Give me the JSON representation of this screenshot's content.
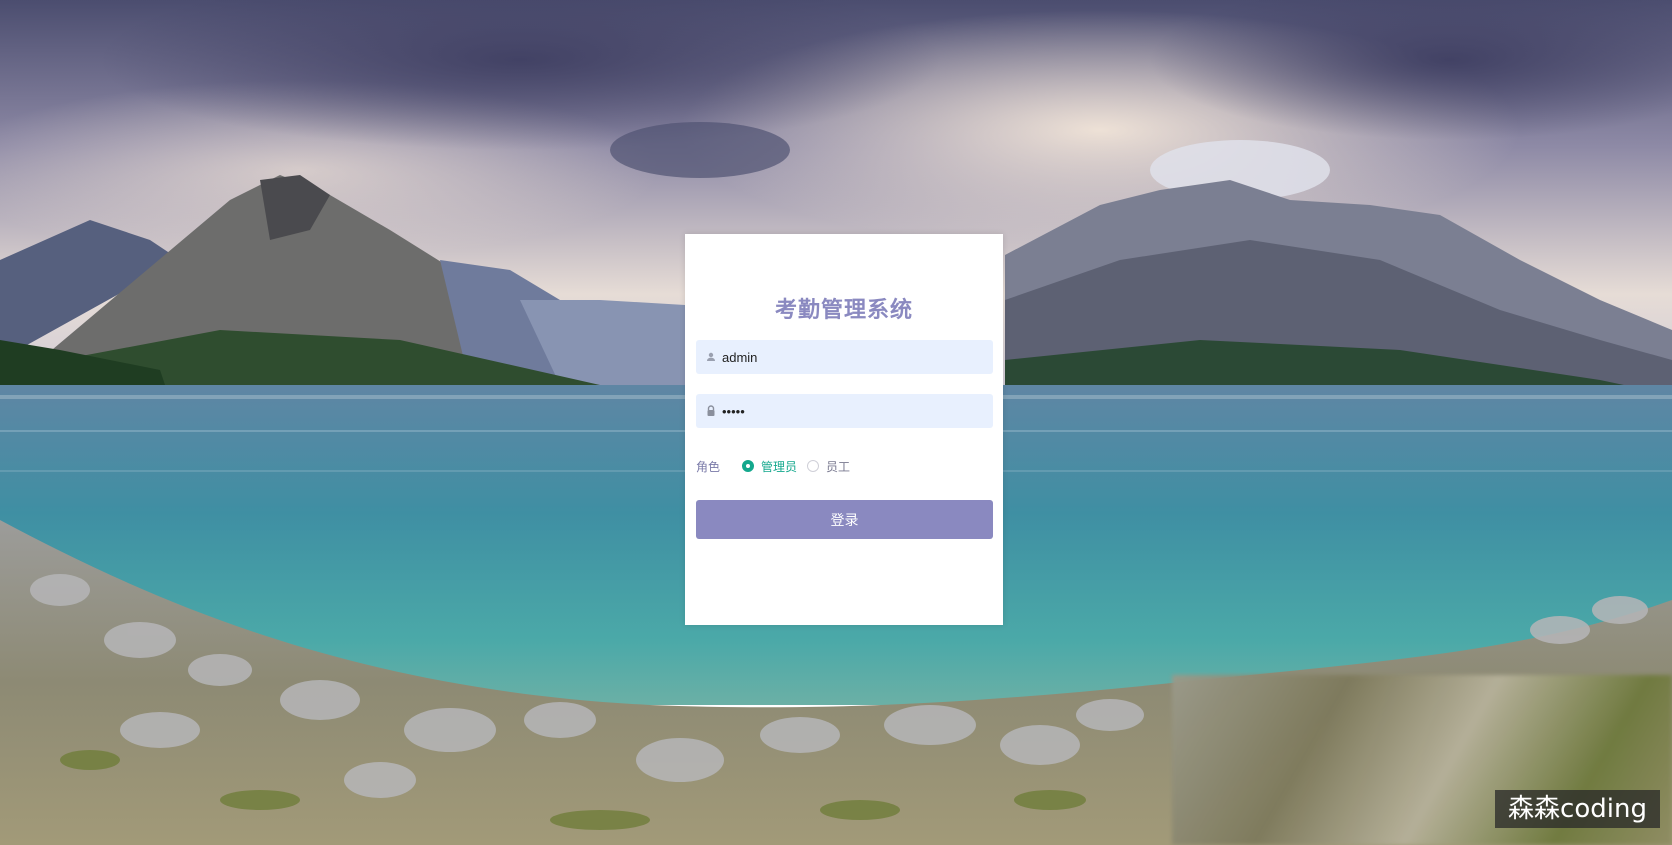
{
  "app": {
    "title": "考勤管理系统"
  },
  "form": {
    "username": {
      "value": "admin",
      "icon": "user-icon"
    },
    "password": {
      "value": "•••••",
      "icon": "lock-icon"
    },
    "role": {
      "label": "角色",
      "options": [
        {
          "label": "管理员",
          "checked": true
        },
        {
          "label": "员工",
          "checked": false
        }
      ]
    },
    "submit_label": "登录"
  },
  "watermark": "森森coding",
  "colors": {
    "accent": "#8a89c0",
    "radio_checked": "#14a88d",
    "input_bg": "#e8f0fe"
  }
}
